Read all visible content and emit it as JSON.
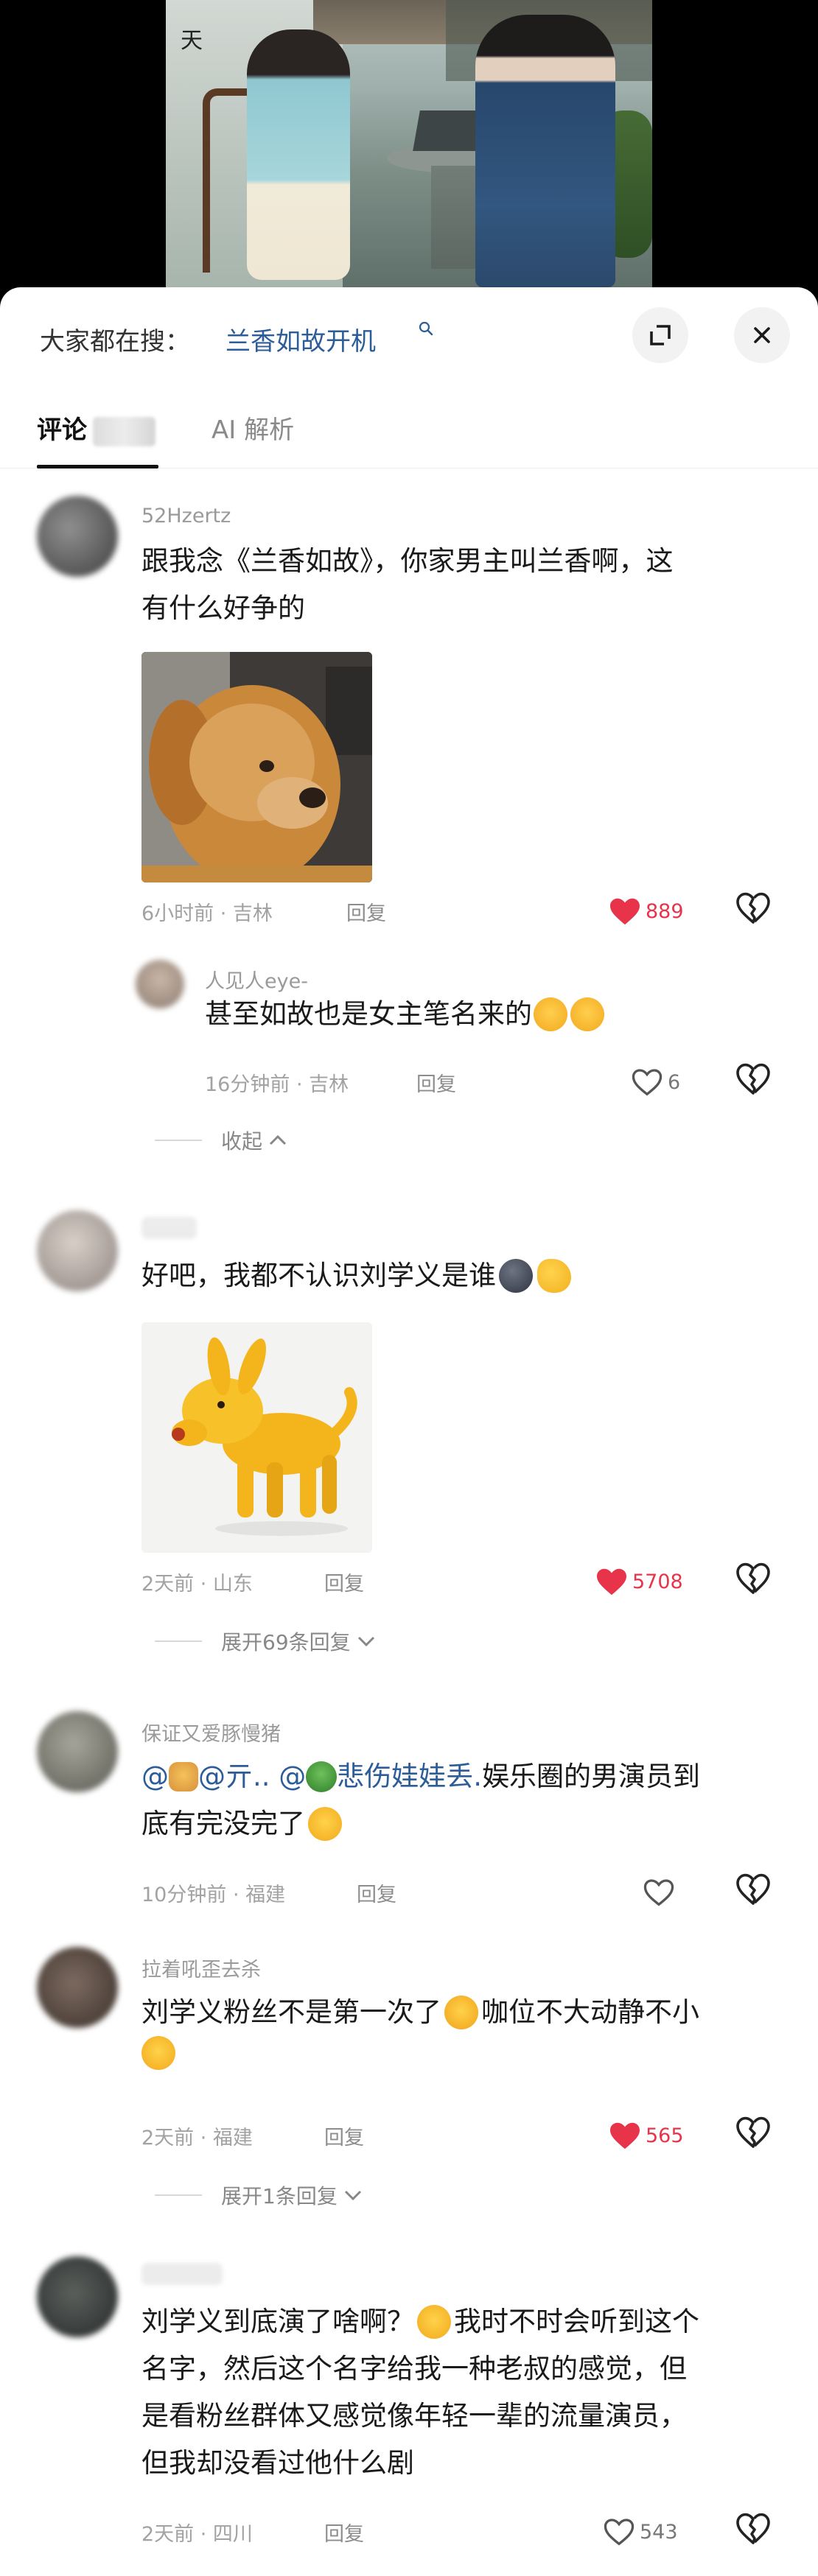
{
  "colors": {
    "accent_like": "#e8344b",
    "link": "#2c5d99",
    "muted": "#9a9a9a"
  },
  "video": {
    "title_char": "天"
  },
  "search": {
    "label": "大家都在搜：",
    "query": "兰香如故开机",
    "icon": "search-icon"
  },
  "buttons": {
    "expand_icon": "expand-icon",
    "close_icon": "close-icon"
  },
  "tabs": [
    {
      "label": "评论"
    },
    {
      "label": "AI 解析"
    }
  ],
  "comments": [
    {
      "username": "52Hzertz",
      "text_line1": "跟我念《兰香如故》，你家男主叫兰香啊，这",
      "text_line2": "有什么好争的",
      "meta": "6小时前 · 吉林",
      "reply": "回复",
      "likes": "889",
      "liked": true
    },
    {
      "username": "人见人eye-",
      "text": "甚至如故也是女主笔名来的",
      "meta": "16分钟前 · 吉林",
      "reply": "回复",
      "likes": "6",
      "liked": false,
      "collapse": "收起"
    },
    {
      "text": "好吧，我都不认识刘学义是谁",
      "meta": "2天前 · 山东",
      "reply": "回复",
      "likes": "5708",
      "liked": true,
      "expand": "展开69条回复"
    },
    {
      "username": "保证又爱豚慢猪",
      "text_prefix_1": "@",
      "text_prefix_2": " @亓.. @",
      "mention": "悲伤娃娃丢.",
      "text_rest": " 娱乐圈的男演员到",
      "text_line2": "底有完没完了",
      "meta": "10分钟前 · 福建",
      "reply": "回复",
      "liked": false
    },
    {
      "username": "拉着吼歪去杀",
      "text_line1a": "刘学义粉丝不是第一次了",
      "text_line1b": "咖位不大动静不小",
      "meta": "2天前 · 福建",
      "reply": "回复",
      "likes": "565",
      "liked": true,
      "expand": "展开1条回复"
    },
    {
      "text_line1a": "刘学义到底演了啥啊？",
      "text_line1b": "我时不时会听到这个",
      "text_line2": "名字，然后这个名字给我一种老叔的感觉，但",
      "text_line3": "是看粉丝群体又感觉像年轻一辈的流量演员，",
      "text_line4": "但我却没看过他什么剧",
      "meta": "2天前 · 四川",
      "reply": "回复",
      "likes": "543",
      "liked": false
    }
  ]
}
